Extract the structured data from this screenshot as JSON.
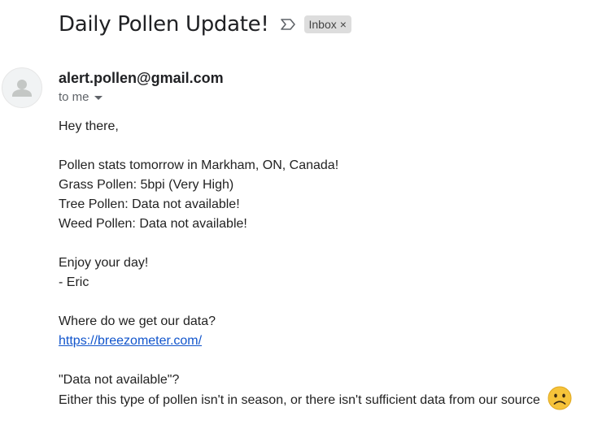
{
  "email": {
    "subject": "Daily Pollen Update!",
    "label_chip": "Inbox",
    "label_remove": "×",
    "sender": "alert.pollen@gmail.com",
    "recipient": "to me",
    "body": {
      "greeting": "Hey there,",
      "stats_intro": "Pollen stats tomorrow in Markham, ON, Canada!",
      "grass": "Grass Pollen: 5bpi (Very High)",
      "tree": "Tree Pollen: Data not available!",
      "weed": "Weed Pollen: Data not available!",
      "sign_off": "Enjoy your day!",
      "signature": "- Eric",
      "source_question": "Where do we get our data?",
      "source_link": "https://breezometer.com/",
      "na_question": "\"Data not available\"?",
      "na_explanation": "Either this type of pollen isn't in season, or there isn't sufficient data from our source"
    },
    "icons": {
      "importance": "importance-marker-icon",
      "avatar": "default-avatar-icon",
      "dropdown": "chevron-down-icon",
      "emoji": "frowning-face-emoji"
    }
  }
}
